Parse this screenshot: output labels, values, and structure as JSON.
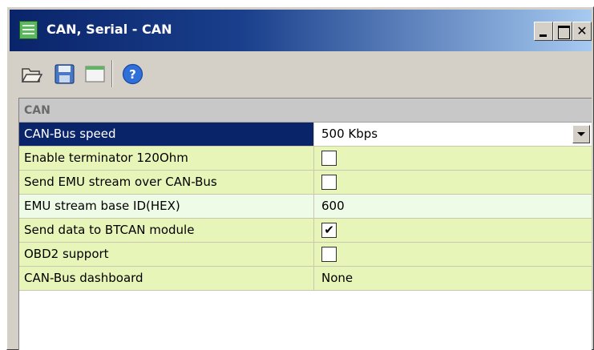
{
  "window": {
    "title": "CAN, Serial - CAN",
    "buttons": {
      "minimize": "minimize",
      "maximize": "maximize",
      "close": "✕"
    }
  },
  "toolbar": {
    "items": [
      {
        "icon": "folder-open-icon"
      },
      {
        "icon": "floppy-save-icon"
      },
      {
        "icon": "window-view-icon"
      },
      {
        "icon": "help-icon",
        "glyph": "?"
      }
    ]
  },
  "grid": {
    "group": "CAN",
    "rows": [
      {
        "label": "CAN-Bus speed",
        "value": "500 Kbps",
        "type": "dropdown",
        "selected": true
      },
      {
        "label": "Enable terminator 120Ohm",
        "type": "checkbox",
        "checked": false
      },
      {
        "label": "Send EMU stream over CAN-Bus",
        "type": "checkbox",
        "checked": false
      },
      {
        "label": "EMU stream base ID(HEX)",
        "value": "600",
        "type": "text"
      },
      {
        "label": "Send data to BTCAN module",
        "type": "checkbox",
        "checked": true,
        "mark": "✔"
      },
      {
        "label": "OBD2 support",
        "type": "checkbox",
        "checked": false
      },
      {
        "label": "CAN-Bus dashboard",
        "value": "None",
        "type": "text"
      }
    ]
  },
  "colors": {
    "selection": "#0a246a",
    "row_green": "#e8f5b8",
    "row_pale": "#eefbe6",
    "group_header": "#c8c8c8"
  }
}
